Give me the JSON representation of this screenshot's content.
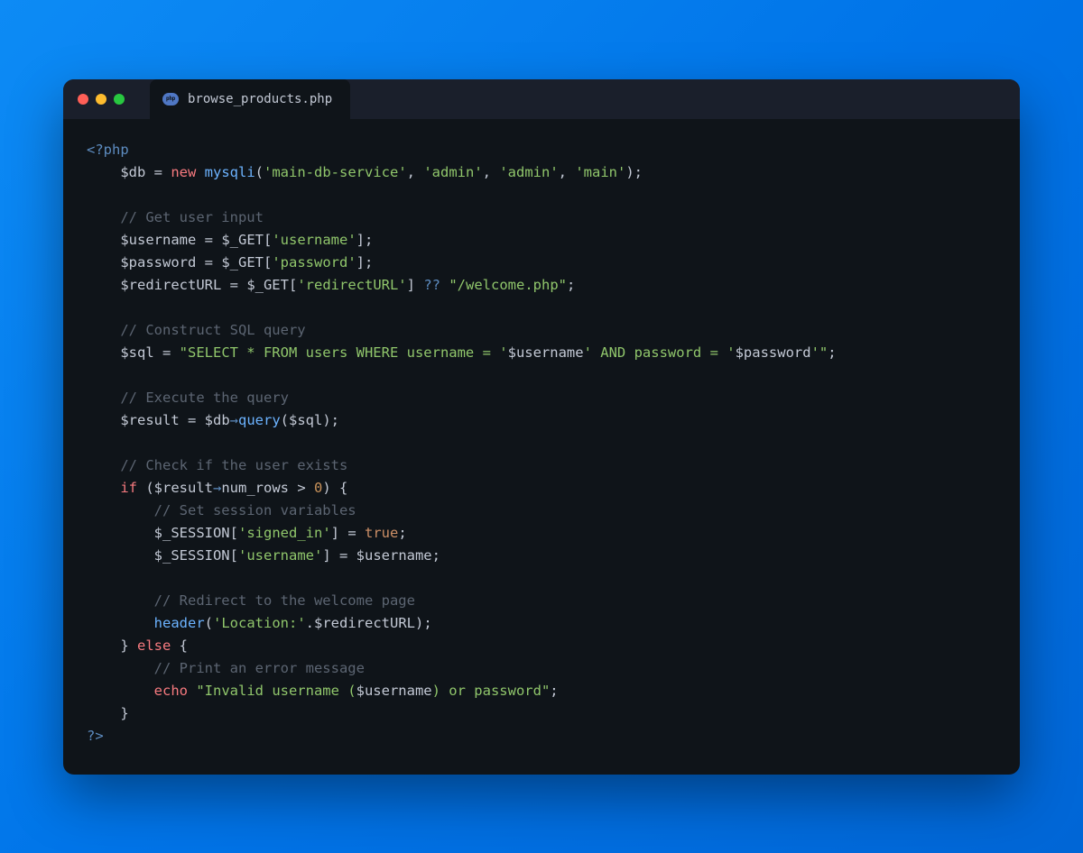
{
  "tab": {
    "filename": "browse_products.php",
    "icon": "php-badge-icon"
  },
  "traffic_lights": {
    "close": "#ff5f57",
    "minimize": "#febc2e",
    "maximize": "#28c840"
  },
  "code": {
    "open_tag": "<?php",
    "close_tag": "?>",
    "l1": {
      "var_db": "$db",
      "eq": " = ",
      "kw_new": "new",
      "sp": " ",
      "fn": "mysqli",
      "open": "(",
      "a1": "'main-db-service'",
      "c": ", ",
      "a2": "'admin'",
      "a3": "'admin'",
      "a4": "'main'",
      "close": ");"
    },
    "c_get_input": "// Get user input",
    "l_user": {
      "var": "$username",
      "eq": " = ",
      "get": "$_GET",
      "br": "[",
      "key": "'username'",
      "cl": "];"
    },
    "l_pass": {
      "var": "$password",
      "eq": " = ",
      "get": "$_GET",
      "br": "[",
      "key": "'password'",
      "cl": "];"
    },
    "l_redir": {
      "var": "$redirectURL",
      "eq": " = ",
      "get": "$_GET",
      "br": "[",
      "key": "'redirectURL'",
      "cl": "] ",
      "coalesce": "??",
      "sp": " ",
      "def": "\"/welcome.php\"",
      "semi": ";"
    },
    "c_construct": "// Construct SQL query",
    "l_sql": {
      "var": "$sql",
      "eq": " = ",
      "q1": "\"SELECT * FROM users WHERE username = '",
      "v1": "$username",
      "q2": "' AND password = '",
      "v2": "$password",
      "q3": "'\"",
      "semi": ";"
    },
    "c_exec": "// Execute the query",
    "l_result": {
      "var": "$result",
      "eq": " = ",
      "obj": "$db",
      "arrow": "→",
      "fn": "query",
      "open": "(",
      "arg": "$sql",
      "close": ");"
    },
    "c_check": "// Check if the user exists",
    "l_if": {
      "kw": "if",
      "sp": " (",
      "obj": "$result",
      "arrow": "→",
      "prop": "num_rows",
      "cmp": " > ",
      "zero": "0",
      "close": ") {"
    },
    "c_session": "// Set session variables",
    "l_sess1": {
      "sess": "$_SESSION",
      "br": "[",
      "key": "'signed_in'",
      "cl": "] = ",
      "val": "true",
      "semi": ";"
    },
    "l_sess2": {
      "sess": "$_SESSION",
      "br": "[",
      "key": "'username'",
      "cl": "] = ",
      "val": "$username",
      "semi": ";"
    },
    "c_redirect": "// Redirect to the welcome page",
    "l_header": {
      "fn": "header",
      "open": "(",
      "str": "'Location:'",
      "dot": ".",
      "var": "$redirectURL",
      "close": ");"
    },
    "l_else": {
      "brace": "}",
      "sp": " ",
      "kw": "else",
      "open": " {"
    },
    "c_err": "// Print an error message",
    "l_echo": {
      "kw": "echo",
      "sp": " ",
      "q1": "\"Invalid username (",
      "v": "$username",
      "q2": ") or password\"",
      "semi": ";"
    },
    "l_endif": "}"
  }
}
